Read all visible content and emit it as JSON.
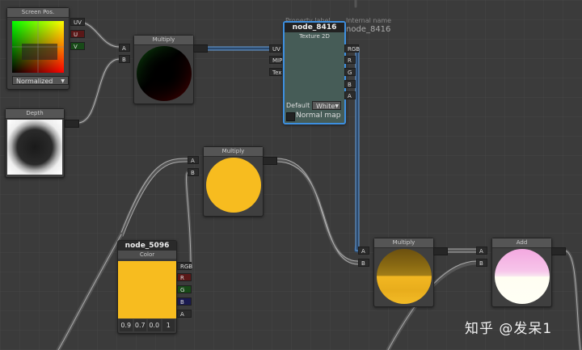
{
  "nodes": {
    "screenpos": {
      "title": "Screen Pos.",
      "outputs": [
        "UV",
        "U",
        "V"
      ],
      "mode": "Normalized"
    },
    "depth": {
      "title": "Depth"
    },
    "multiply_top": {
      "title": "Multiply",
      "inputs": [
        "A",
        "B"
      ]
    },
    "texture": {
      "property_label": "Property label",
      "internal_name_label": "Internal name",
      "internal_name": "node_8416",
      "name": "node_8416",
      "subtitle": "Texture 2D",
      "inputs": [
        "UV",
        "MIP",
        "Tex"
      ],
      "outputs": [
        "RGB",
        "R",
        "G",
        "B",
        "A"
      ],
      "default_label": "Default",
      "default_value": "White",
      "normal_map_label": "Normal map"
    },
    "multiply_mid": {
      "title": "Multiply",
      "inputs": [
        "A",
        "B"
      ]
    },
    "color": {
      "name": "node_5096",
      "subtitle": "Color",
      "outputs": [
        "RGB",
        "R",
        "G",
        "B",
        "A"
      ],
      "values": [
        "0.9",
        "0.7",
        "0.0",
        "1"
      ],
      "swatch": "#f7bc1f"
    },
    "multiply_bottom": {
      "title": "Multiply",
      "inputs": [
        "A",
        "B"
      ]
    },
    "add": {
      "title": "Add",
      "inputs": [
        "A",
        "B"
      ]
    }
  },
  "watermark": "知乎 @发呆1",
  "colors": {
    "wire": "#a8a8a8",
    "texture_wire": "#6a9fd8",
    "selection": "#3d8fe0",
    "color_value": "#f7bc1f"
  }
}
